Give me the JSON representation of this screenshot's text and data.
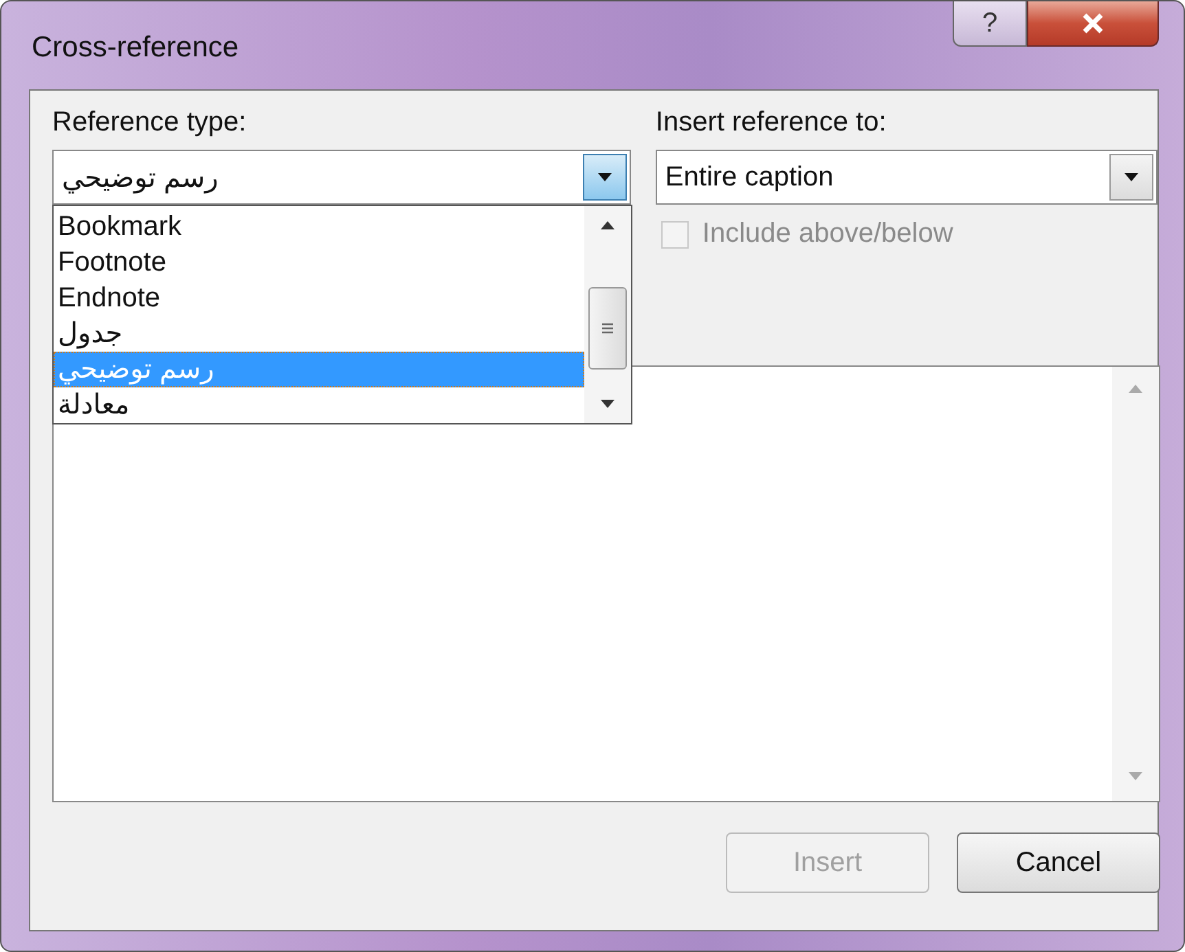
{
  "window": {
    "title": "Cross-reference",
    "help_button": "?"
  },
  "reference_type": {
    "label": "Reference type:",
    "value": "رسم توضيحي",
    "items": [
      {
        "label": "Bookmark",
        "selected": false
      },
      {
        "label": "Footnote",
        "selected": false
      },
      {
        "label": "Endnote",
        "selected": false
      },
      {
        "label": "جدول",
        "selected": false
      },
      {
        "label": "رسم توضيحي",
        "selected": true
      },
      {
        "label": "معادلة",
        "selected": false
      }
    ]
  },
  "insert_reference_to": {
    "label": "Insert reference to:",
    "value": "Entire caption"
  },
  "include_above_below": {
    "label": "Include above/below",
    "checked": false,
    "disabled": true
  },
  "buttons": [
    {
      "label": "Insert",
      "disabled": true
    },
    {
      "label": "Cancel",
      "disabled": false
    }
  ]
}
